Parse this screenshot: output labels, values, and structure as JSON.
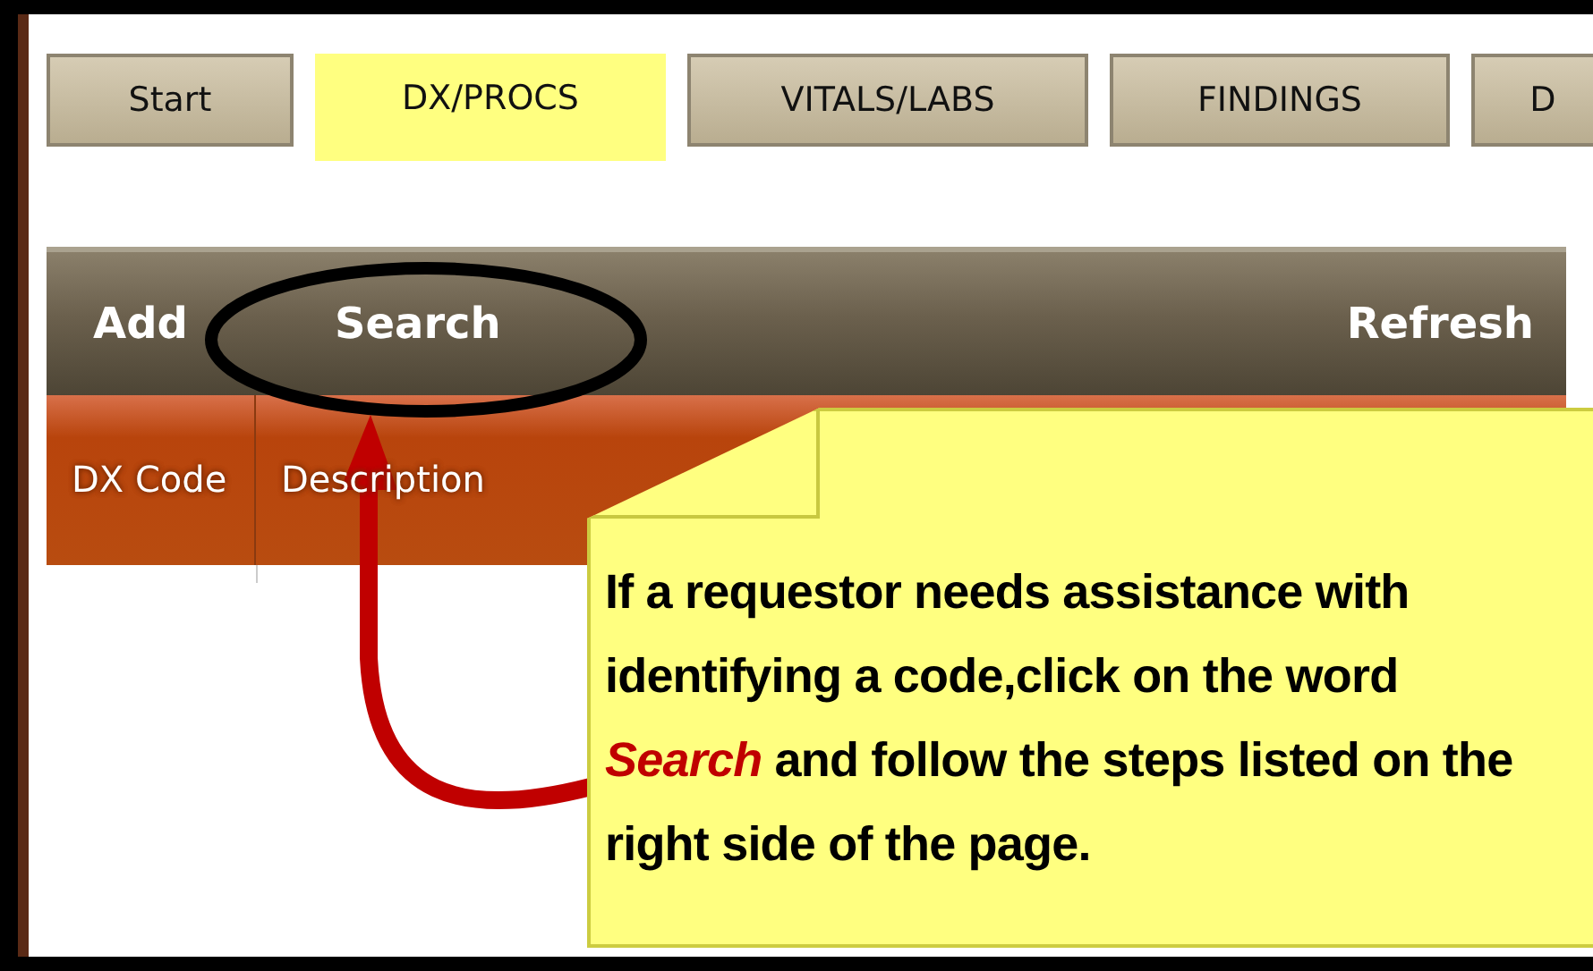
{
  "tabs": [
    {
      "label": "Start",
      "selected": false
    },
    {
      "label": "DX/PROCS",
      "selected": true
    },
    {
      "label": "VITALS/LABS",
      "selected": false
    },
    {
      "label": "FINDINGS",
      "selected": false
    },
    {
      "label": "D",
      "selected": false
    }
  ],
  "toolbar": {
    "left": [
      "Add",
      "Search"
    ],
    "right": "Refresh"
  },
  "table": {
    "columns": [
      "DX Code",
      "Description"
    ]
  },
  "callout": {
    "text": "If a requestor needs assistance with identifying a code,click on the word *Search* and follow the steps listed on the right side of the page."
  }
}
